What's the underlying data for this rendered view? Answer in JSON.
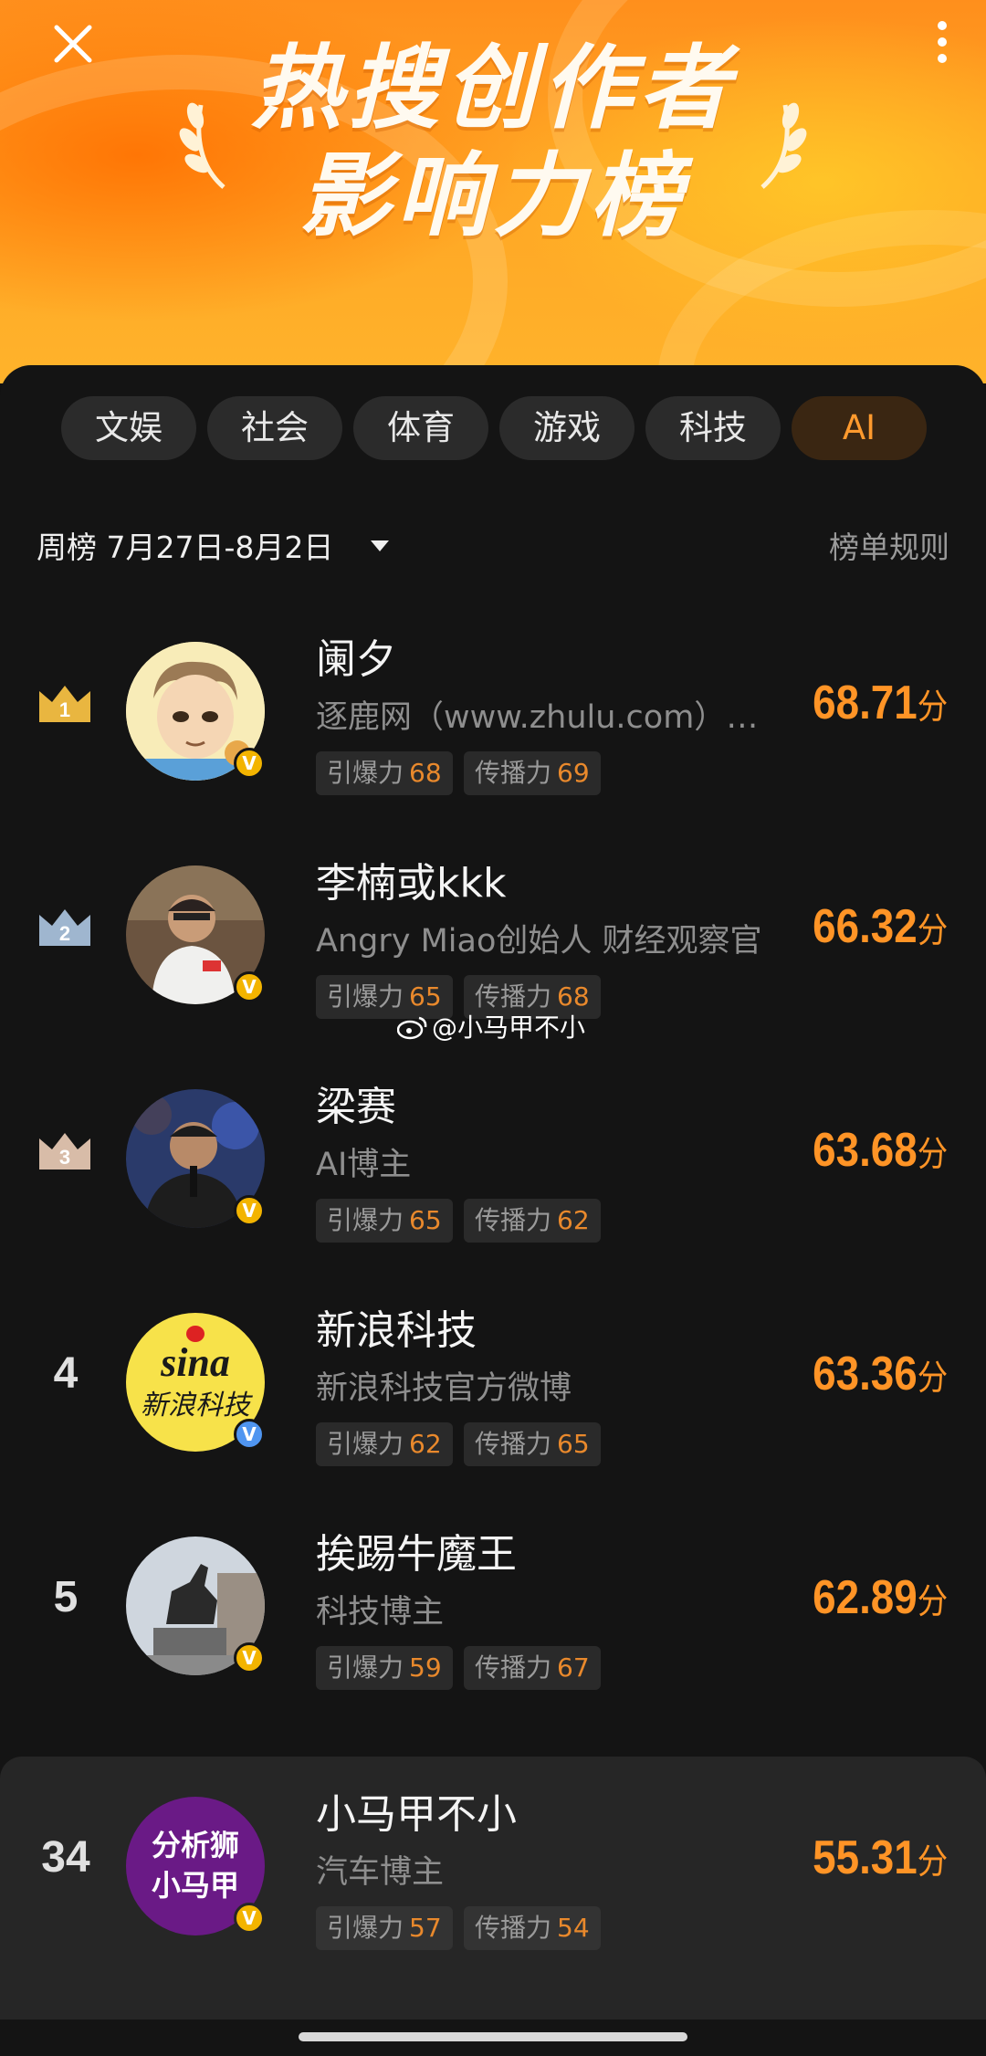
{
  "header": {
    "title_line1": "热搜创作者",
    "title_line2": "影响力榜",
    "close_icon": "close-icon",
    "more_icon": "more-vertical-icon"
  },
  "tabs": [
    {
      "label": "文娱",
      "active": false
    },
    {
      "label": "社会",
      "active": false
    },
    {
      "label": "体育",
      "active": false
    },
    {
      "label": "游戏",
      "active": false
    },
    {
      "label": "科技",
      "active": false
    },
    {
      "label": "AI",
      "active": true
    }
  ],
  "period": {
    "label": "周榜 7月27日-8月2日",
    "rules_link": "榜单规则"
  },
  "labels": {
    "burst": "引爆力",
    "spread": "传播力",
    "score_unit": "分"
  },
  "colors": {
    "accent": "#ff9426",
    "active_tab_text": "#ff9a2e",
    "verified_gold": "#f3b400",
    "verified_blue": "#4f95f0"
  },
  "ranking": [
    {
      "rank": "1",
      "name": "阑夕",
      "desc": "逐鹿网（www.zhulu.com）创始人",
      "burst": "68",
      "spread": "69",
      "score": "68.71",
      "badge": "gold",
      "crown": "gold-crown-icon"
    },
    {
      "rank": "2",
      "name": "李楠或kkk",
      "desc": "Angry Miao创始人 财经观察官",
      "burst": "65",
      "spread": "68",
      "score": "66.32",
      "badge": "gold",
      "crown": "silver-crown-icon"
    },
    {
      "rank": "3",
      "name": "梁赛",
      "desc": "AI博主",
      "burst": "65",
      "spread": "62",
      "score": "63.68",
      "badge": "gold",
      "crown": "bronze-crown-icon"
    },
    {
      "rank": "4",
      "name": "新浪科技",
      "desc": "新浪科技官方微博",
      "burst": "62",
      "spread": "65",
      "score": "63.36",
      "badge": "blue"
    },
    {
      "rank": "5",
      "name": "挨踢牛魔王",
      "desc": "科技博主",
      "burst": "59",
      "spread": "67",
      "score": "62.89",
      "badge": "gold"
    }
  ],
  "my_rank": {
    "rank": "34",
    "name": "小马甲不小",
    "desc": "汽车博主",
    "burst": "57",
    "spread": "54",
    "score": "55.31",
    "badge": "gold",
    "avatar_text_1": "分析狮",
    "avatar_text_2": "小马甲"
  },
  "avatar4_text": {
    "line1": "sina",
    "line2": "新浪科技"
  },
  "watermark": "@小马甲不小"
}
